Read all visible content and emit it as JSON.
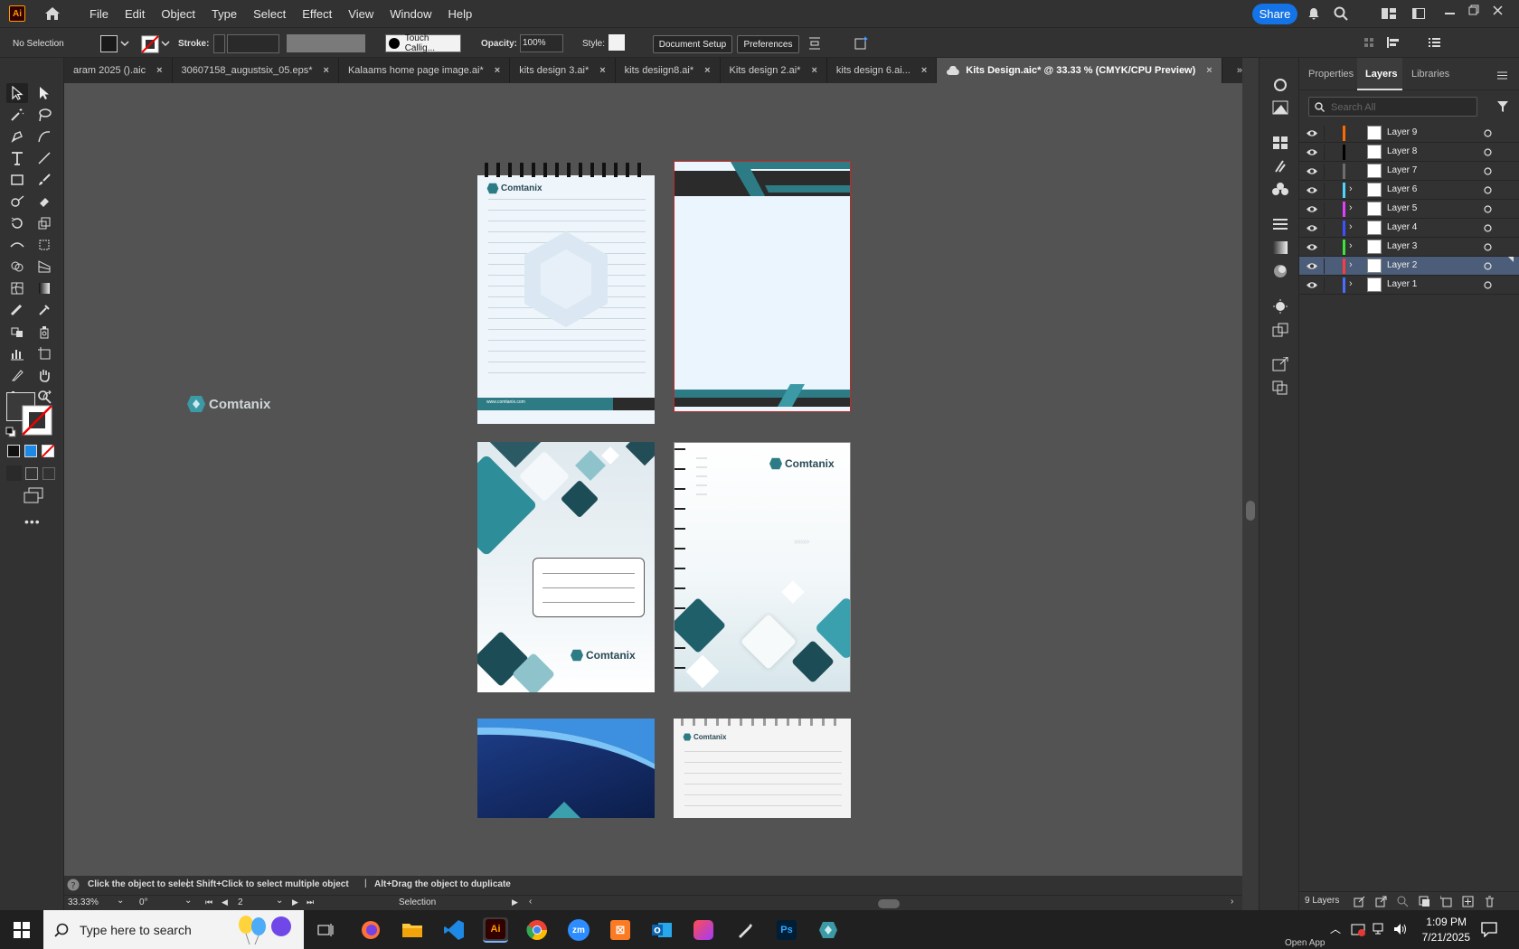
{
  "app": {
    "logo": "Ai",
    "share_label": "Share"
  },
  "menu": [
    "File",
    "Edit",
    "Object",
    "Type",
    "Select",
    "Effect",
    "View",
    "Window",
    "Help"
  ],
  "control": {
    "selection": "No Selection",
    "stroke_label": "Stroke:",
    "brush": "Touch Callig...",
    "opacity_label": "Opacity:",
    "opacity_value": "100%",
    "style_label": "Style:",
    "doc_setup": "Document Setup",
    "preferences": "Preferences"
  },
  "tabs": [
    {
      "label": "aram 2025 ().aic"
    },
    {
      "label": "30607158_augustsix_05.eps*"
    },
    {
      "label": "Kalaams home page image.ai*"
    },
    {
      "label": "kits design 3.ai*"
    },
    {
      "label": "kits desiign8.ai*"
    },
    {
      "label": "Kits design 2.ai*"
    },
    {
      "label": "kits design 6.ai..."
    },
    {
      "label": "Kits Design.aic* @ 33.33 % (CMYK/CPU Preview)"
    }
  ],
  "canvas": {
    "brand": "Comtanix",
    "website": "www.comtanix.com"
  },
  "panel": {
    "tabs": [
      "Properties",
      "Layers",
      "Libraries"
    ],
    "search_placeholder": "Search All",
    "layers": [
      {
        "name": "Layer 9",
        "color": "#ff6a00"
      },
      {
        "name": "Layer 8",
        "color": "#000000"
      },
      {
        "name": "Layer 7",
        "color": "#6e6e6e"
      },
      {
        "name": "Layer 6",
        "color": "#4fd3ff"
      },
      {
        "name": "Layer 5",
        "color": "#e040fb"
      },
      {
        "name": "Layer 4",
        "color": "#3f51ff"
      },
      {
        "name": "Layer 3",
        "color": "#39e639"
      },
      {
        "name": "Layer 2",
        "color": "#ff3b3b"
      },
      {
        "name": "Layer 1",
        "color": "#4a6cff"
      }
    ],
    "footer": "9 Layers"
  },
  "status": {
    "hint1": "Click the object to select",
    "hint2": "Shift+Click to select multiple object",
    "hint3": "Alt+Drag the object to duplicate",
    "zoom": "33.33%",
    "rotation": "0°",
    "artboard": "2",
    "tool": "Selection"
  },
  "taskbar": {
    "search_placeholder": "Type here to search",
    "time": "1:09 PM",
    "date": "7/21/2025",
    "open_app": "Open App"
  },
  "colors": {
    "accent": "#1473e6",
    "teal": "#2d7c85",
    "dark": "#2b2b2b"
  }
}
